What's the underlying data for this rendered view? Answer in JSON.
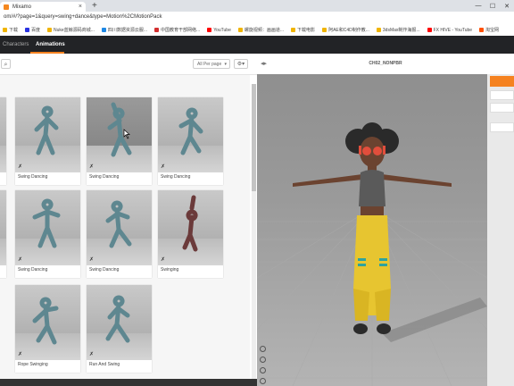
{
  "browser": {
    "tab_title": "Mixamo",
    "new_tab": "+",
    "close_tab": "×",
    "address": "om/#/?page=1&query=swing+dance&type=Motion%2CMotionPack",
    "window_controls": {
      "minimize": "—",
      "maximize": "☐",
      "close": "✕"
    }
  },
  "bookmarks": [
    {
      "label": "下载",
      "color": "#f0b400"
    },
    {
      "label": "百度",
      "color": "#2932e1"
    },
    {
      "label": "Nuke蓝鲸源码商城...",
      "color": "#f0b400"
    },
    {
      "label": "四川数据资源云服...",
      "color": "#1e88e5"
    },
    {
      "label": "中国教育干部网络...",
      "color": "#d32f2f"
    },
    {
      "label": "YouTube",
      "color": "#ff0000"
    },
    {
      "label": "螺旋视频：画画道...",
      "color": "#f0b400"
    },
    {
      "label": "下载电影",
      "color": "#f0b400"
    },
    {
      "label": "阿AE和C4D制作教...",
      "color": "#f0b400"
    },
    {
      "label": "3dsMax制作海报...",
      "color": "#f0b400"
    },
    {
      "label": "FX HIVE - YouTube",
      "color": "#ff0000"
    },
    {
      "label": "淘宝网",
      "color": "#ff5000"
    }
  ],
  "nav": {
    "characters": "Characters",
    "animations": "Animations"
  },
  "toolbar": {
    "search_icon": "⌕",
    "per_page": "All Per page",
    "per_page_caret": "▾",
    "settings": "⚙▾"
  },
  "cards": [
    {
      "label": "Swing Dancing",
      "icon": "dance-icon"
    },
    {
      "label": "Swing Dancing",
      "icon": "dance-icon"
    },
    {
      "label": "Swing Dancing",
      "icon": "dance-icon"
    },
    {
      "label": "Swing Dancing",
      "icon": "dance-icon"
    },
    {
      "label": "Swing Dancing",
      "icon": "dance-icon"
    },
    {
      "label": "Swinging",
      "icon": "dance-icon"
    },
    {
      "label": "Rope Swinging",
      "icon": "dance-icon"
    },
    {
      "label": "Run And Swing",
      "icon": "dance-icon"
    }
  ],
  "dance_icon": "✗",
  "viewer": {
    "character_name": "CH02_NONPBR",
    "panel_icon": "◂▸"
  },
  "colors": {
    "accent": "#f58220",
    "nav_bg": "#222326",
    "viewport": "#9d9d9d"
  }
}
